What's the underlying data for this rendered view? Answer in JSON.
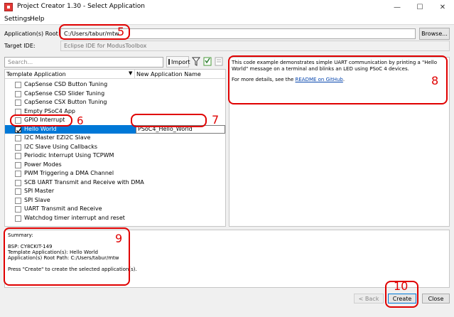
{
  "window": {
    "title": "Project Creator 1.30 - Select Application",
    "minimize": "—",
    "maximize": "☐",
    "close": "✕"
  },
  "menu": {
    "items": [
      "Settings",
      "Help"
    ]
  },
  "root_path": {
    "label": "Application(s) Root Path:",
    "value": "C:/Users/tabur/mtw",
    "browse": "Browse..."
  },
  "target_ide": {
    "label": "Target IDE:",
    "value": "Eclipse IDE for ModusToolbox"
  },
  "search": {
    "placeholder": "Search...",
    "import_label": "Import"
  },
  "table": {
    "col_template": "Template Application",
    "col_new_name": "New Application Name",
    "rows": [
      {
        "name": "CapSense CSD Button Tuning",
        "checked": false
      },
      {
        "name": "CapSense CSD Slider Tuning",
        "checked": false
      },
      {
        "name": "CapSense CSX Button Tuning",
        "checked": false
      },
      {
        "name": "Empty PSoC4 App",
        "checked": false
      },
      {
        "name": "GPIO Interrupt",
        "checked": false
      },
      {
        "name": "Hello World",
        "checked": true,
        "new_name": "PSoC4_Hello_World"
      },
      {
        "name": "I2C Master EZI2C Slave",
        "checked": false
      },
      {
        "name": "I2C Slave Using Callbacks",
        "checked": false
      },
      {
        "name": "Periodic Interrupt Using TCPWM",
        "checked": false
      },
      {
        "name": "Power Modes",
        "checked": false
      },
      {
        "name": "PWM Triggering a DMA Channel",
        "checked": false
      },
      {
        "name": "SCB UART Transmit and Receive with DMA",
        "checked": false
      },
      {
        "name": "SPI Master",
        "checked": false
      },
      {
        "name": "SPI Slave",
        "checked": false
      },
      {
        "name": "UART Transmit and Receive",
        "checked": false
      },
      {
        "name": "Watchdog timer interrupt and reset",
        "checked": false
      }
    ]
  },
  "description": {
    "text": "This code example demonstrates simple UART communication by printing a \"Hello World\" message on a terminal and blinks an LED using PSoC 4 devices.",
    "more_prefix": "For more details, see the ",
    "more_link": "README on GitHub",
    "more_suffix": "."
  },
  "summary": {
    "title": "Summary:",
    "bsp": "BSP: CY8CKIT-149",
    "templates": "Template Application(s): Hello World",
    "root": "Application(s) Root Path: C:/Users/tabur/mtw",
    "hint": "Press \"Create\" to create the selected application(s)."
  },
  "buttons": {
    "back": "< Back",
    "create": "Create",
    "close": "Close"
  },
  "annotations": {
    "n5": "5",
    "n6": "6",
    "n7": "7",
    "n8": "8",
    "n9": "9",
    "n10": "10",
    "color": "#e00000"
  },
  "colors": {
    "selection": "#0078d7",
    "accent_red": "#e00000"
  }
}
